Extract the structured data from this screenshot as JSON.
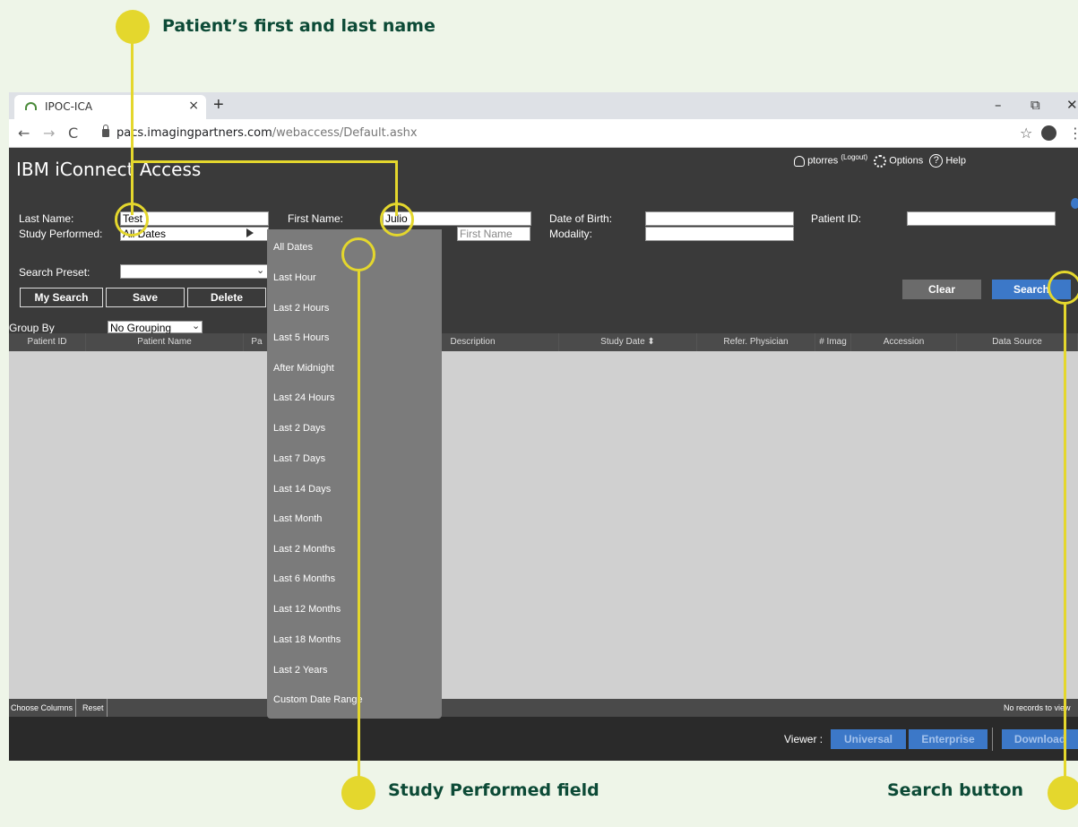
{
  "callouts": {
    "name": "Patient’s first and last name",
    "study": "Study Performed field",
    "search": "Search button"
  },
  "browser": {
    "tab_title": "IPOC-ICA",
    "tab_close": "×",
    "new_tab": "+",
    "url_host": "pacs.imagingpartners.com",
    "url_path": "/webaccess/Default.ashx",
    "win_min": "–",
    "win_max": "⧉",
    "win_close": "✕",
    "back": "←",
    "forward": "→",
    "reload": "C",
    "star": "☆",
    "menu": "⋮"
  },
  "app": {
    "title": "IBM iConnect Access",
    "user": "ptorres",
    "logout": "(Logout)",
    "options": "Options",
    "help": "Help"
  },
  "form": {
    "last_name_label": "Last Name:",
    "last_name_value": "Test",
    "first_name_label": "First Name:",
    "first_name_value": "Julio",
    "first_name_ph": "First Name",
    "dob_label": "Date of Birth:",
    "patient_id_label": "Patient ID:",
    "study_label": "Study Performed:",
    "study_value": "All Dates",
    "modality_label": "Modality:",
    "preset_label": "Search Preset:",
    "my_search": "My Search",
    "save": "Save",
    "delete": "Delete",
    "clear": "Clear",
    "search": "Search"
  },
  "grid": {
    "group_by_label": "Group By",
    "group_by_value": "No Grouping",
    "columns": [
      "Patient ID",
      "Patient Name",
      "Pa",
      "Description",
      "Study Date ⬍",
      "Refer. Physician",
      "# Imag",
      "Accession",
      "Data Source"
    ],
    "choose_columns": "Choose Columns",
    "reset": "Reset",
    "no_records": "No records to view"
  },
  "viewer": {
    "label": "Viewer :",
    "universal": "Universal",
    "enterprise": "Enterprise",
    "download": "Download"
  },
  "dropdown": {
    "options": [
      "All Dates",
      "Last Hour",
      "Last 2 Hours",
      "Last 5 Hours",
      "After Midnight",
      "Last 24 Hours",
      "Last 2 Days",
      "Last 7 Days",
      "Last 14 Days",
      "Last Month",
      "Last 2 Months",
      "Last 6 Months",
      "Last 12 Months",
      "Last 18 Months",
      "Last 2 Years",
      "Custom Date Range"
    ]
  }
}
